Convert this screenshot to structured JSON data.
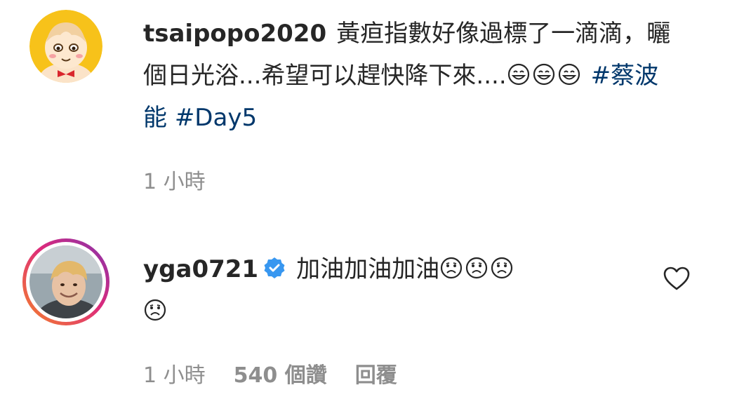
{
  "caption": {
    "username": "tsaipopo2020",
    "text": "黃疸指數好像過標了一滴滴，曬個日光浴...希望可以趕快降下來....",
    "emojis": [
      "grinning-face-icon",
      "grinning-face-icon",
      "grinning-face-icon"
    ],
    "hashtags": [
      "#蔡波能",
      "#Day5"
    ],
    "timestamp": "1 小時"
  },
  "comment": {
    "username": "yga0721",
    "verified": true,
    "text": "加油加油加油",
    "emojis": [
      "worried-face-icon",
      "worried-face-icon",
      "worried-face-icon",
      "worried-face-icon"
    ],
    "timestamp": "1 小時",
    "likes": "540 個讚",
    "reply_label": "回覆"
  },
  "colors": {
    "text": "#262626",
    "muted": "#8e8e8e",
    "hashtag": "#00376b",
    "verified": "#3897f0",
    "story_ring_start": "#f58529",
    "story_ring_end": "#8134af"
  }
}
